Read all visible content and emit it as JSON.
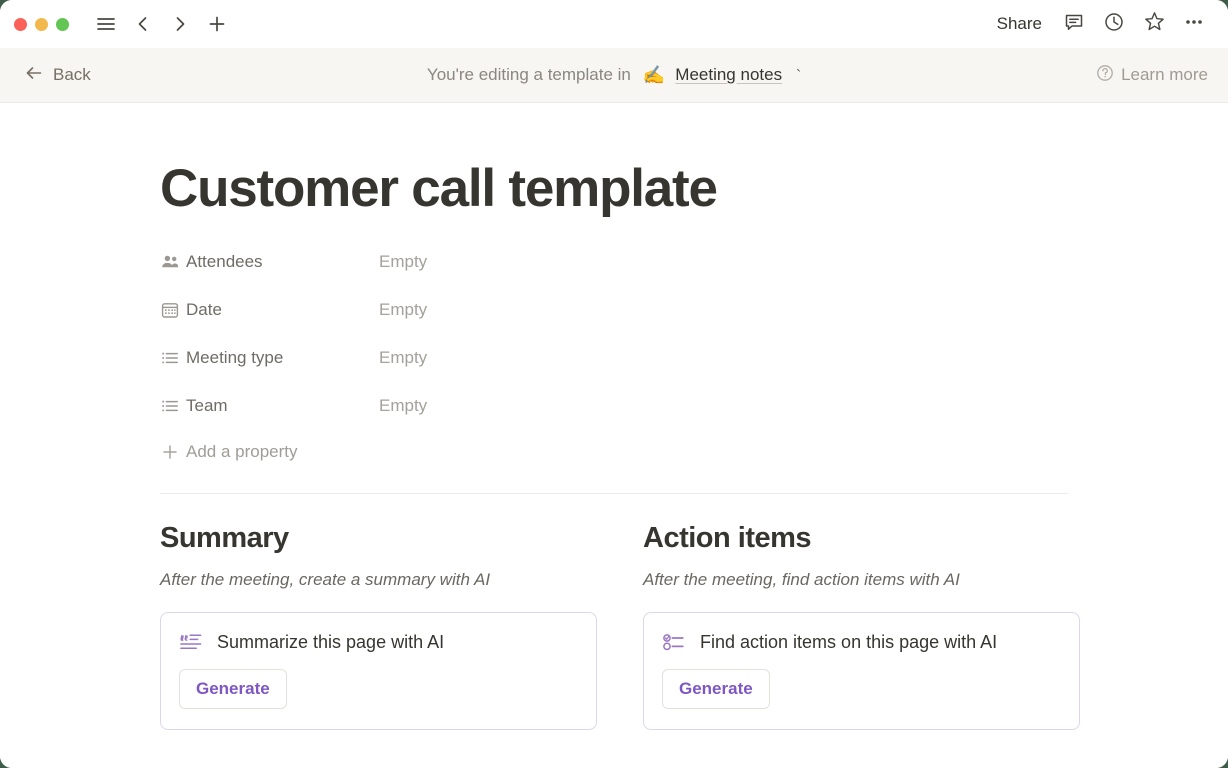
{
  "window": {
    "traffic_lights": [
      {
        "name": "close",
        "color": "#fa6159"
      },
      {
        "name": "minimize",
        "color": "#f2b84b"
      },
      {
        "name": "maximize",
        "color": "#62c554"
      }
    ],
    "backdrop_color": "#3f5c48"
  },
  "titlebar": {
    "nav": [
      {
        "icon": "sidebar-menu-icon",
        "name": "menu-button"
      },
      {
        "icon": "chevron-left-icon",
        "name": "back-nav-button"
      },
      {
        "icon": "chevron-right-icon",
        "name": "forward-nav-button"
      },
      {
        "icon": "plus-icon",
        "name": "new-page-button"
      }
    ],
    "share_label": "Share",
    "actions": [
      {
        "icon": "comment-icon",
        "name": "comments-button"
      },
      {
        "icon": "clock-history-icon",
        "name": "updates-button"
      },
      {
        "icon": "star-icon",
        "name": "favorite-button"
      },
      {
        "icon": "ellipsis-icon",
        "name": "more-options-button"
      }
    ]
  },
  "banner": {
    "back_label": "Back",
    "message": "You're editing a template in",
    "emoji": "✍️",
    "database_link": "Meeting notes",
    "trailing_tick": "`",
    "learn_more_label": "Learn more"
  },
  "page": {
    "title": "Customer call template",
    "properties": [
      {
        "icon": "people-icon",
        "label": "Attendees",
        "value": "Empty"
      },
      {
        "icon": "calendar-icon",
        "label": "Date",
        "value": "Empty"
      },
      {
        "icon": "list-select-icon",
        "label": "Meeting type",
        "value": "Empty"
      },
      {
        "icon": "list-select-icon",
        "label": "Team",
        "value": "Empty"
      }
    ],
    "add_property_label": "Add a property"
  },
  "sections": [
    {
      "title": "Summary",
      "subtitle": "After the meeting, create a summary with AI",
      "card": {
        "icon": "quote-summary-icon",
        "title": "Summarize this page with AI",
        "button_label": "Generate"
      }
    },
    {
      "title": "Action items",
      "subtitle": "After the meeting, find action items with AI",
      "card": {
        "icon": "checklist-icon",
        "title": "Find action items on this page with AI",
        "button_label": "Generate"
      }
    }
  ],
  "colors": {
    "accent_purple": "#7e57c2",
    "card_border": "#dfd5e8",
    "banner_bg": "#f7f6f3",
    "text_primary": "#37352f",
    "text_muted": "#a5a19b"
  }
}
